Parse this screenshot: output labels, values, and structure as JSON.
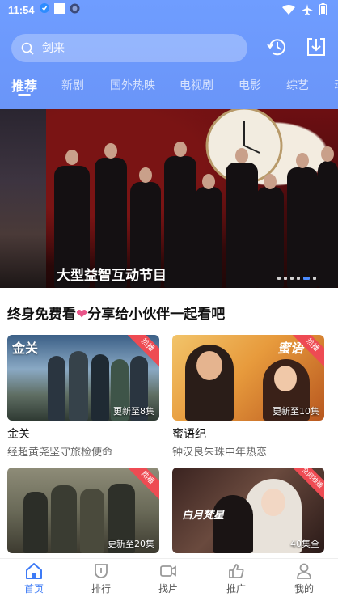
{
  "status_bar": {
    "time": "11:54"
  },
  "search": {
    "placeholder": "剑来"
  },
  "tabs": [
    {
      "label": "推荐",
      "active": true
    },
    {
      "label": "新剧",
      "active": false
    },
    {
      "label": "国外热映",
      "active": false
    },
    {
      "label": "电视剧",
      "active": false
    },
    {
      "label": "电影",
      "active": false
    },
    {
      "label": "综艺",
      "active": false
    },
    {
      "label": "动",
      "active": false
    }
  ],
  "banner": {
    "title": "大型益智互动节目",
    "slide_count": 6,
    "active_slide": 5
  },
  "section": {
    "title_prefix": "终身免费看",
    "title_suffix": "分享给小伙伴一起看吧"
  },
  "cards": [
    {
      "title": "金关",
      "desc": "经超黄尧坚守旅检使命",
      "badge": "热播",
      "update": "更新至8集",
      "logo_text": "金关"
    },
    {
      "title": "蜜语纪",
      "desc": "钟汉良朱珠中年热恋",
      "badge": "热播",
      "update": "更新至10集",
      "logo_text": "蜜语"
    },
    {
      "title": "",
      "desc": "",
      "badge": "热播",
      "update": "更新至20集",
      "logo_text": ""
    },
    {
      "title": "",
      "desc": "",
      "badge": "全网独播",
      "update": "40集全",
      "logo_text": "白月梵星"
    }
  ],
  "bottom_nav": [
    {
      "label": "首页",
      "icon": "home-icon",
      "active": true
    },
    {
      "label": "排行",
      "icon": "ranking-icon",
      "active": false
    },
    {
      "label": "找片",
      "icon": "video-icon",
      "active": false
    },
    {
      "label": "推广",
      "icon": "thumbs-up-icon",
      "active": false
    },
    {
      "label": "我的",
      "icon": "user-icon",
      "active": false
    }
  ],
  "colors": {
    "header_blue": "#6c98fb",
    "accent_blue": "#3e7bf6",
    "badge_red": "#ee4b53",
    "heart_pink": "#e9568a"
  }
}
